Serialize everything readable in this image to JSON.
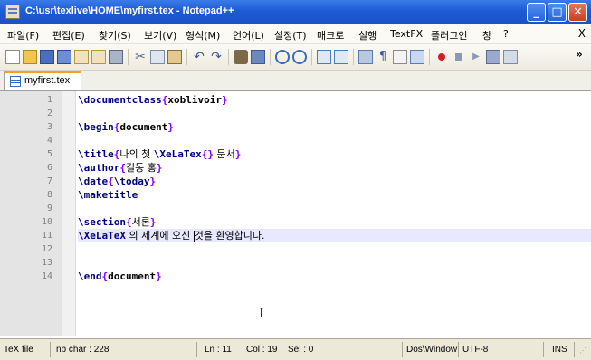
{
  "window": {
    "title": "C:\\usr\\texlive\\HOME\\myfirst.tex - Notepad++"
  },
  "menu": [
    "파일(F)",
    "편집(E)",
    "찾기(S)",
    "보기(V)",
    "형식(M)",
    "언어(L)",
    "설정(T)",
    "매크로",
    "실행",
    "TextFX",
    "플러그인",
    "창",
    "?"
  ],
  "menu_close": "X",
  "toolbar_overflow": "»",
  "tab": {
    "label": "myfirst.tex"
  },
  "editor": {
    "line_numbers": [
      "1",
      "2",
      "3",
      "4",
      "5",
      "6",
      "7",
      "8",
      "9",
      "10",
      "11",
      "12",
      "13",
      "14"
    ],
    "current_line": 11
  },
  "code": {
    "l1": {
      "cmd": "\\documentclass",
      "open": "{",
      "arg": "xoblivoir",
      "close": "}"
    },
    "l3": {
      "cmd": "\\begin",
      "open": "{",
      "arg": "document",
      "close": "}"
    },
    "l5": {
      "cmd": "\\title",
      "open": "{",
      "text1": "나의 첫 ",
      "cmd2": "\\XeLaTex",
      "empty": "{}",
      "text2": " 문서",
      "close": "}"
    },
    "l6": {
      "cmd": "\\author",
      "open": "{",
      "text": "길동 홍",
      "close": "}"
    },
    "l7": {
      "cmd": "\\date",
      "open": "{",
      "arg": "\\today",
      "close": "}"
    },
    "l8": {
      "cmd": "\\maketitle"
    },
    "l10": {
      "cmd": "\\section",
      "open": "{",
      "text": "서론",
      "close": "}"
    },
    "l11": {
      "cmd": "\\XeLaTeX",
      "text1": " 의 세계에 오신 ",
      "text2": "것을 환영합니다."
    },
    "l13": {
      "cmd": "\\end",
      "open": "{",
      "arg": "document",
      "close": "}"
    }
  },
  "status": {
    "lang": "TeX file",
    "chars": "nb char : 228",
    "ln": "Ln : 11",
    "col": "Col : 19",
    "sel": "Sel : 0",
    "eol": "Dos\\Window",
    "enc": "UTF-8",
    "mode": "INS"
  },
  "colors": {
    "title_bar": "#1d5bd6",
    "keyword": "#000080",
    "brace": "#8000ff",
    "current_line": "#e8e8ff",
    "active_tab_accent": "#f6a02c"
  }
}
